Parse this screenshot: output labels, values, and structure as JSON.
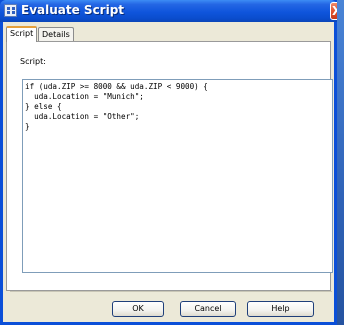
{
  "window": {
    "title": "Evaluate Script",
    "close_label": "X"
  },
  "tabs": [
    {
      "label": "Script",
      "selected": true
    },
    {
      "label": "Details",
      "selected": false
    }
  ],
  "script": {
    "label": "Script:",
    "lines": [
      "if (uda.ZIP >= 8000 && uda.ZIP < 9000) {",
      "  uda.Location = \"Munich\";",
      "} else {",
      "  uda.Location = \"Other\";",
      "}"
    ]
  },
  "buttons": {
    "ok": "OK",
    "cancel": "Cancel",
    "help": "Help"
  },
  "colors": {
    "titlebar": "#0b4fd8",
    "client": "#ece9d8",
    "close": "#e0532f"
  }
}
